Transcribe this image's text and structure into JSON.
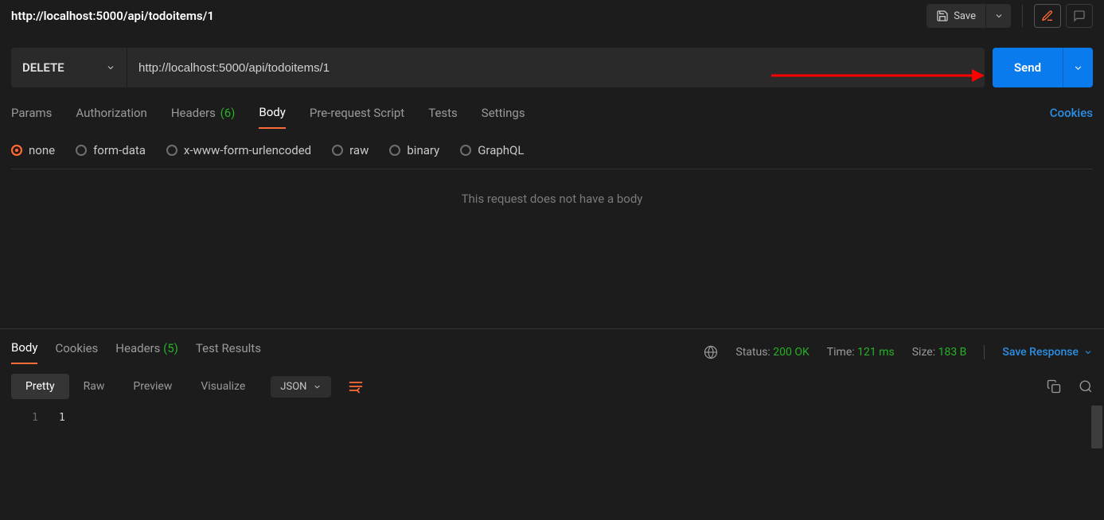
{
  "header": {
    "title": "http://localhost:5000/api/todoitems/1",
    "save_label": "Save"
  },
  "request": {
    "method": "DELETE",
    "url": "http://localhost:5000/api/todoitems/1",
    "send_label": "Send",
    "tabs": {
      "params": "Params",
      "authorization": "Authorization",
      "headers_label": "Headers",
      "headers_count": "(6)",
      "body": "Body",
      "prerequest": "Pre-request Script",
      "tests": "Tests",
      "settings": "Settings"
    },
    "cookies_link": "Cookies",
    "body_types": {
      "none": "none",
      "form_data": "form-data",
      "x_www": "x-www-form-urlencoded",
      "raw": "raw",
      "binary": "binary",
      "graphql": "GraphQL"
    },
    "body_empty_msg": "This request does not have a body"
  },
  "response": {
    "tabs": {
      "body": "Body",
      "cookies": "Cookies",
      "headers_label": "Headers",
      "headers_count": "(5)",
      "test_results": "Test Results"
    },
    "status_label": "Status:",
    "status_value": "200 OK",
    "time_label": "Time:",
    "time_value": "121 ms",
    "size_label": "Size:",
    "size_value": "183 B",
    "save_response": "Save Response",
    "view_modes": {
      "pretty": "Pretty",
      "raw": "Raw",
      "preview": "Preview",
      "visualize": "Visualize"
    },
    "format_select": "JSON",
    "code": {
      "line1_no": "1",
      "line1_text": "1"
    }
  }
}
